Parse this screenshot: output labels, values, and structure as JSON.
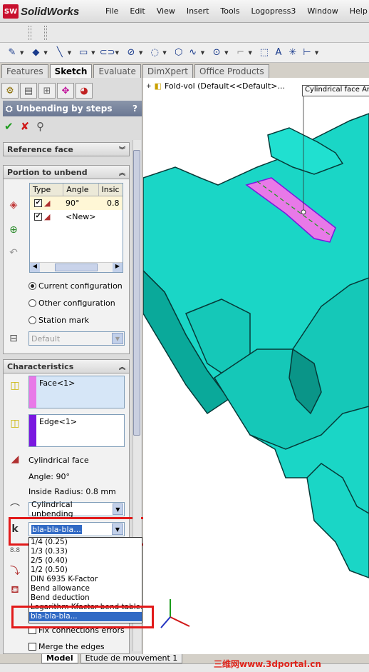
{
  "app": {
    "brand": "SolidWorks",
    "logo_mark": "SW"
  },
  "menu": [
    "File",
    "Edit",
    "View",
    "Insert",
    "Tools",
    "Logopress3",
    "Window",
    "Help"
  ],
  "command_tabs": [
    {
      "label": "Features",
      "active": false
    },
    {
      "label": "Sketch",
      "active": true
    },
    {
      "label": "Evaluate",
      "active": false
    },
    {
      "label": "DimXpert",
      "active": false
    },
    {
      "label": "Office Products",
      "active": false
    }
  ],
  "property_manager": {
    "title": "Unbending by steps",
    "help": "?",
    "reference_face": {
      "header": "Reference face"
    },
    "portion_to_unbend": {
      "header": "Portion to unbend",
      "columns": [
        "Type",
        "Angle",
        "Insic"
      ],
      "rows": [
        {
          "checked": true,
          "angle": "90°",
          "inside": "0.8"
        },
        {
          "checked": true,
          "angle": "<New>",
          "inside": ""
        }
      ],
      "options": [
        {
          "label": "Current configuration",
          "selected": true
        },
        {
          "label": "Other configuration",
          "selected": false
        },
        {
          "label": "Station mark",
          "selected": false
        }
      ],
      "config_value": "Default"
    },
    "characteristics": {
      "header": "Characteristics",
      "face_item": "Face<1>",
      "edge_item": "Edge<1>",
      "face_type": "Cylindrical face",
      "angle": "Angle: 90°",
      "radius": "Inside Radius: 0.8 mm",
      "unbend_type": "Cylindrical unbending",
      "kfactor_value": "bla-bla-bla...",
      "kfactor_options": [
        "1/4 (0.25)",
        "1/3 (0.33)",
        "2/5 (0.40)",
        "1/2 (0.50)",
        "DIN 6935 K-Factor",
        "Bend allowance",
        "Bend deduction",
        "Logarithm Kfactor bend table.xls",
        "bla-bla-bla..."
      ],
      "kfactor_selected_index": 8,
      "fix_connections": "Fix connections errors",
      "merge_edges": "Merge the edges"
    }
  },
  "graphics": {
    "tree_root": "Fold-vol  (Default<<Default>...",
    "callout": "Cylindrical face An",
    "colors": {
      "part": "#1ad6c6",
      "highlight": "#e879e8",
      "edge": "#7a18e0"
    }
  },
  "bottom_tabs": [
    "Model",
    "Etude de mouvement 1"
  ],
  "watermark": "三维网www.3dportal.cn"
}
